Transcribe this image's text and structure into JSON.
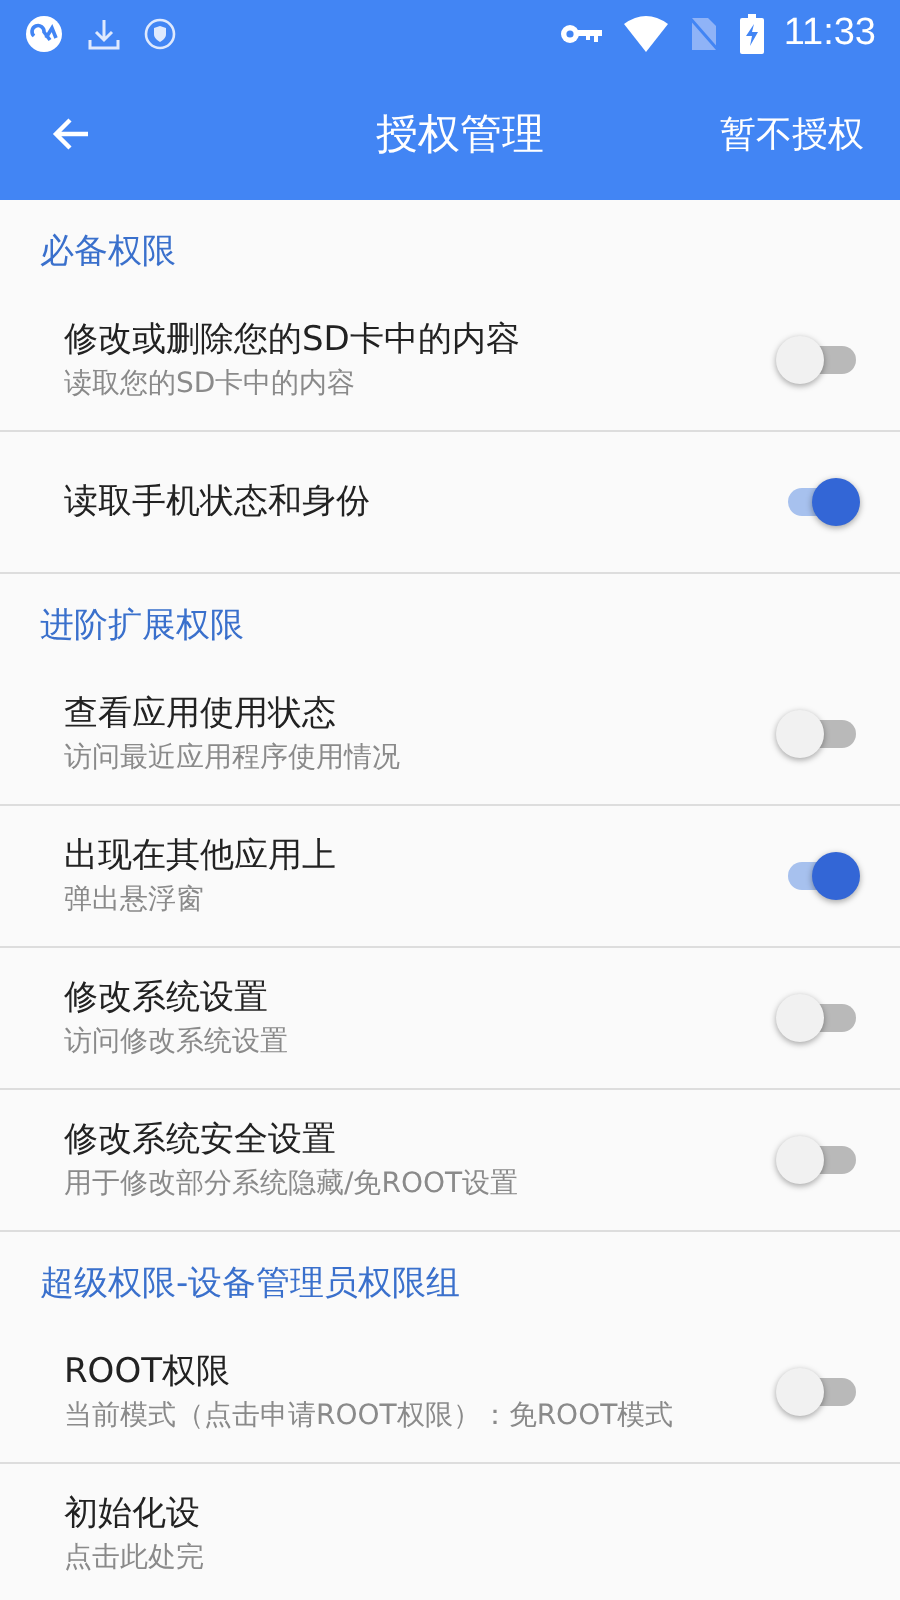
{
  "status_bar": {
    "time": "11:33"
  },
  "app_bar": {
    "title": "授权管理",
    "action": "暂不授权"
  },
  "sections": [
    {
      "title": "必备权限",
      "items": [
        {
          "title": "修改或删除您的SD卡中的内容",
          "subtitle": "读取您的SD卡中的内容",
          "on": false
        },
        {
          "title": "读取手机状态和身份",
          "on": true
        }
      ]
    },
    {
      "title": "进阶扩展权限",
      "items": [
        {
          "title": "查看应用使用状态",
          "subtitle": "访问最近应用程序使用情况",
          "on": false
        },
        {
          "title": "出现在其他应用上",
          "subtitle": "弹出悬浮窗",
          "on": true
        },
        {
          "title": "修改系统设置",
          "subtitle": "访问修改系统设置",
          "on": false
        },
        {
          "title": "修改系统安全设置",
          "subtitle": "用于修改部分系统隐藏/免ROOT设置",
          "on": false
        }
      ]
    },
    {
      "title": "超级权限-设备管理员权限组",
      "items": [
        {
          "title": "ROOT权限",
          "subtitle": "当前模式（点击申请ROOT权限）：免ROOT模式",
          "on": false
        },
        {
          "title": "初始化设",
          "subtitle": "点击此处完"
        }
      ]
    }
  ]
}
